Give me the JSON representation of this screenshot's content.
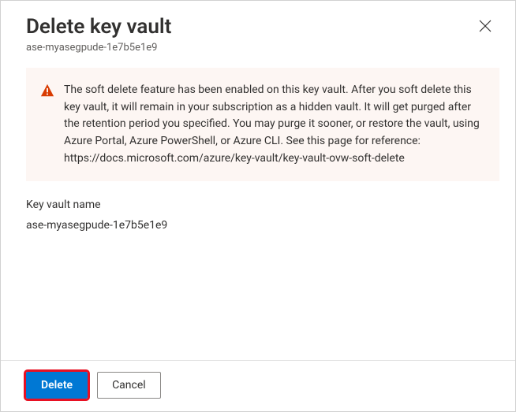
{
  "header": {
    "title": "Delete key vault",
    "subtitle": "ase-myasegpude-1e7b5e1e9",
    "close_icon_name": "close-icon"
  },
  "warning": {
    "icon_name": "warning-icon",
    "text": "The soft delete feature has been enabled on this key vault. After you soft delete this key vault, it will remain in your subscription as a hidden vault. It will get purged after the retention period you specified. You may purge it sooner, or restore the vault, using Azure Portal, Azure PowerShell, or Azure CLI. See this page for reference: https://docs.microsoft.com/azure/key-vault/key-vault-ovw-soft-delete"
  },
  "field": {
    "label": "Key vault name",
    "value": "ase-myasegpude-1e7b5e1e9"
  },
  "footer": {
    "delete_label": "Delete",
    "cancel_label": "Cancel"
  },
  "colors": {
    "primary": "#0078d4",
    "warning_bg": "#FDF6F3",
    "warning_icon": "#d83b01",
    "highlight": "#e81123"
  }
}
